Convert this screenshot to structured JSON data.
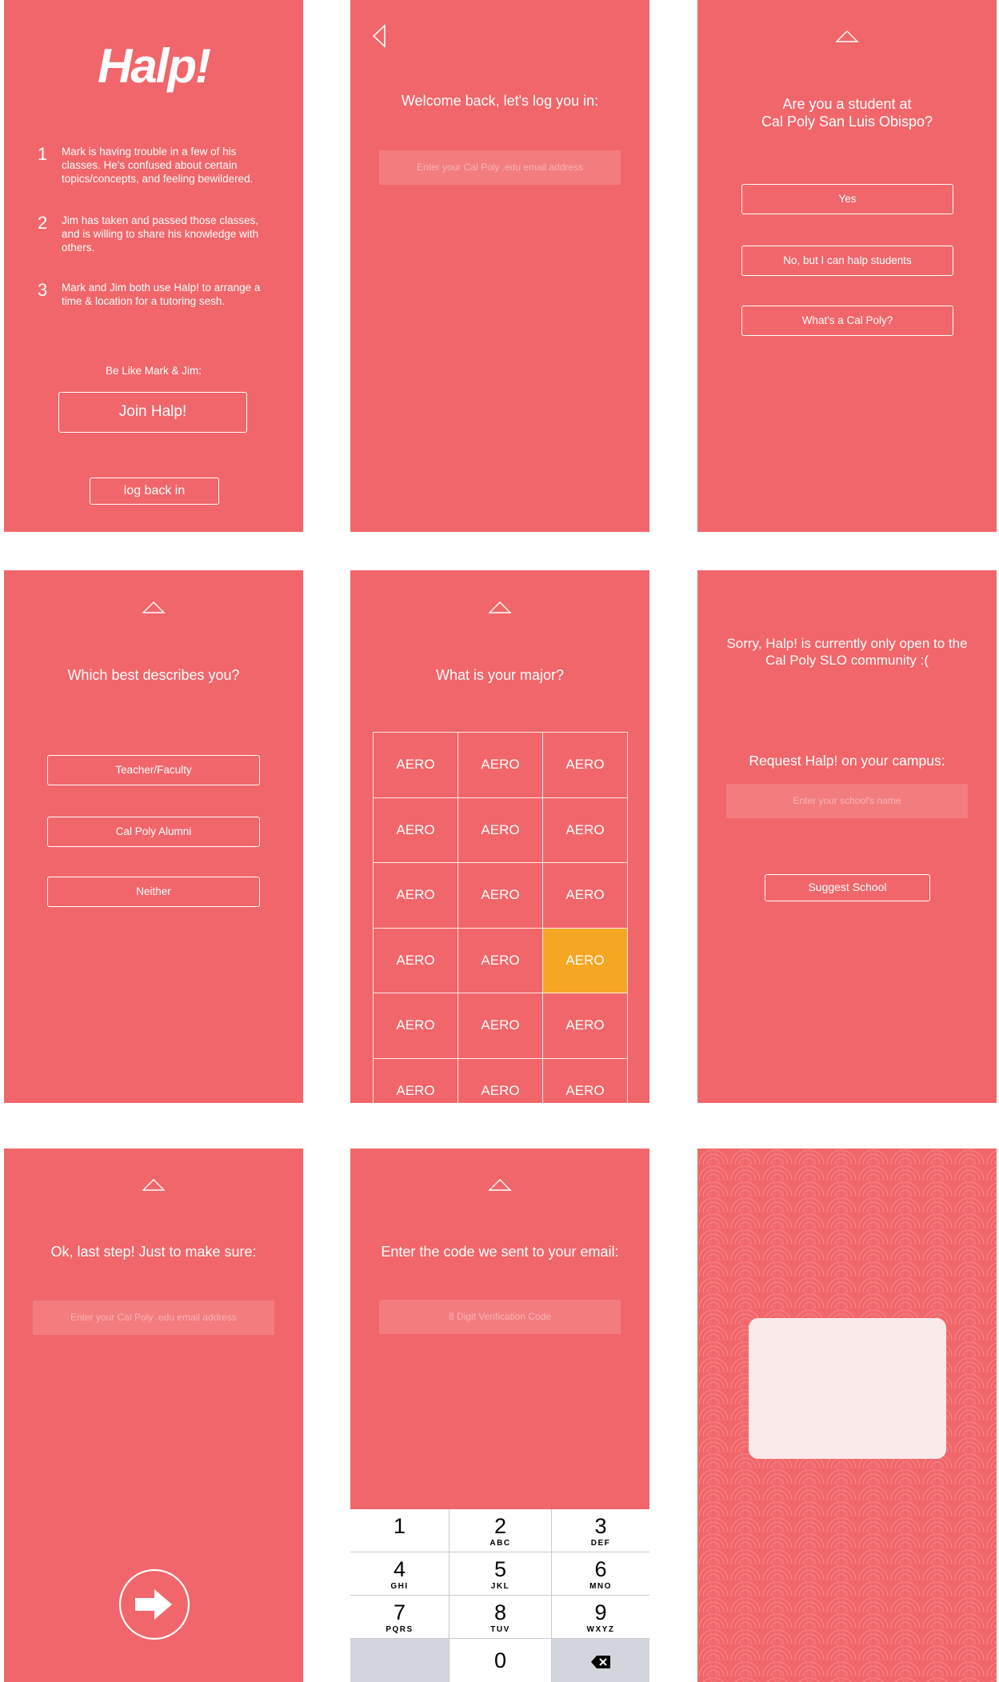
{
  "screen1": {
    "logo": "Halp!",
    "steps": [
      {
        "num": "1",
        "text": "Mark is having trouble in a few of his classes. He's confused about certain topics/concepts, and feeling bewildered."
      },
      {
        "num": "2",
        "text": "Jim has taken and passed those classes, and is willing to share his knowledge with others."
      },
      {
        "num": "3",
        "text": "Mark and Jim both use Halp! to arrange a time & location for a tutoring sesh."
      }
    ],
    "tagline": "Be Like Mark & Jim:",
    "join_label": "Join Halp!",
    "login_label": "log back in"
  },
  "screen2": {
    "title": "Welcome back, let's log you in:",
    "email_placeholder": "Enter your Cal Poly .edu email address"
  },
  "screen3": {
    "title_line1": "Are you a student at",
    "title_line2": "Cal Poly San Luis Obispo?",
    "options": [
      "Yes",
      "No, but I can halp students",
      "What's a Cal Poly?"
    ]
  },
  "screen4": {
    "title": "Which best describes you?",
    "options": [
      "Teacher/Faculty",
      "Cal Poly Alumni",
      "Neither"
    ]
  },
  "screen5": {
    "title": "What is your major?",
    "majors": [
      [
        "AERO",
        "AERO",
        "AERO"
      ],
      [
        "AERO",
        "AERO",
        "AERO"
      ],
      [
        "AERO",
        "AERO",
        "AERO"
      ],
      [
        "AERO",
        "AERO",
        "AERO"
      ],
      [
        "AERO",
        "AERO",
        "AERO"
      ],
      [
        "AERO",
        "AERO",
        "AERO"
      ]
    ],
    "selected": {
      "row": 3,
      "col": 2
    },
    "selected_color": "#f5a623"
  },
  "screen6": {
    "message_line1": "Sorry, Halp! is currently only open to the",
    "message_line2": "Cal Poly SLO community :(",
    "request_title": "Request Halp! on your campus:",
    "school_placeholder": "Enter your school's name",
    "suggest_label": "Suggest School"
  },
  "screen7": {
    "title": "Ok, last step! Just to make sure:",
    "email_placeholder": "Enter your Cal Poly .edu email address"
  },
  "screen8": {
    "title": "Enter the code we sent to your email:",
    "code_placeholder": "8 Digit Verification Code",
    "keys": [
      {
        "digit": "1",
        "letters": ""
      },
      {
        "digit": "2",
        "letters": "ABC"
      },
      {
        "digit": "3",
        "letters": "DEF"
      },
      {
        "digit": "4",
        "letters": "GHI"
      },
      {
        "digit": "5",
        "letters": "JKL"
      },
      {
        "digit": "6",
        "letters": "MNO"
      },
      {
        "digit": "7",
        "letters": "PQRS"
      },
      {
        "digit": "8",
        "letters": "TUV"
      },
      {
        "digit": "9",
        "letters": "WXYZ"
      },
      {
        "digit": "0",
        "letters": ""
      }
    ]
  },
  "colors": {
    "brand": "#f1666a",
    "field": "#f37c7f",
    "accent": "#f5a623",
    "card": "#fbeaea"
  },
  "icons": {
    "back": "back-triangle-icon",
    "up": "up-triangle-icon",
    "next": "arrow-right-icon",
    "backspace": "backspace-icon"
  }
}
